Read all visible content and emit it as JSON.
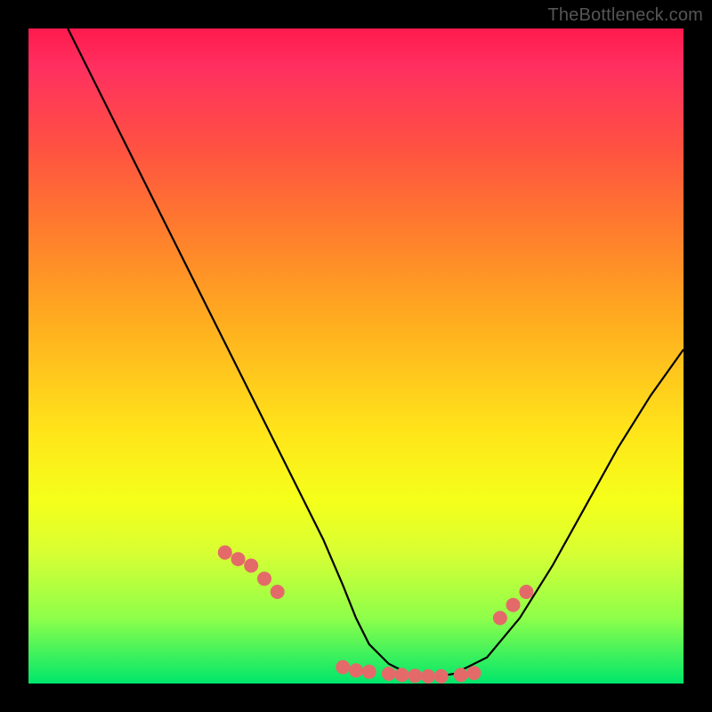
{
  "watermark": "TheBottleneck.com",
  "chart_data": {
    "type": "line",
    "title": "",
    "xlabel": "",
    "ylabel": "",
    "xlim": [
      0,
      100
    ],
    "ylim": [
      0,
      100
    ],
    "series": [
      {
        "name": "bottleneck-curve",
        "x": [
          6,
          10,
          15,
          20,
          25,
          30,
          35,
          40,
          45,
          48,
          50,
          52,
          55,
          58,
          62,
          65,
          70,
          75,
          80,
          85,
          90,
          95,
          100
        ],
        "y": [
          100,
          92,
          82,
          72,
          62,
          52,
          42,
          32,
          22,
          15,
          10,
          6,
          3,
          1.5,
          1,
          1.5,
          4,
          10,
          18,
          27,
          36,
          44,
          51
        ]
      }
    ],
    "markers": {
      "name": "highlight-dots",
      "color": "#e46a6a",
      "x": [
        30,
        32,
        34,
        36,
        38,
        48,
        50,
        52,
        55,
        57,
        59,
        61,
        63,
        66,
        68,
        72,
        74,
        76
      ],
      "y": [
        20,
        19,
        18,
        16,
        14,
        2.5,
        2,
        1.8,
        1.5,
        1.3,
        1.2,
        1.1,
        1.1,
        1.3,
        1.6,
        10,
        12,
        14
      ]
    }
  }
}
